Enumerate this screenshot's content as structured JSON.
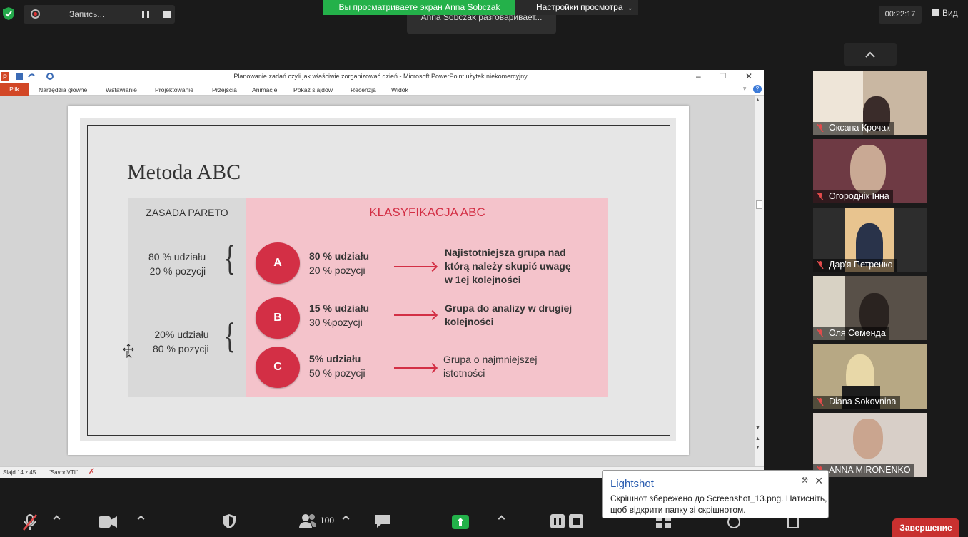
{
  "zoom": {
    "recording_label": "Запись...",
    "viewing_banner": "Вы просматриваете экран Anna Sobczak",
    "view_options": "Настройки просмотра",
    "speaking_label": "Anna Sobczak разговаривает...",
    "timer": "00:22:17",
    "view_button": "Вид",
    "participants_count": "100",
    "end_button": "Завершение",
    "participants": [
      {
        "name": "Оксана Крочак",
        "bg": "#c9b7a2"
      },
      {
        "name": "Огороднік Інна",
        "bg": "#6e3a44"
      },
      {
        "name": "Дар'я Петренко",
        "bg": "#2d2d2d"
      },
      {
        "name": "Оля Семенда",
        "bg": "#585048"
      },
      {
        "name": "Diana Sokovnina",
        "bg": "#b7a884"
      },
      {
        "name": "ANNA MIRONENKO",
        "bg": "#d8cfc8"
      }
    ]
  },
  "ppt": {
    "title": "Planowanie zadań czyli jak właściwie zorganizować dzień - Microsoft PowerPoint użytek niekomercyjny",
    "tabs": [
      "Plik",
      "Narzędzia główne",
      "Wstawianie",
      "Projektowanie",
      "Przejścia",
      "Animacje",
      "Pokaz slajdów",
      "Recenzja",
      "Widok"
    ],
    "status_slide": "Slajd 14 z 45",
    "status_theme": "\"SavonVTI\"",
    "slide": {
      "title": "Metoda ABC",
      "pareto_header": "ZASADA PARETO",
      "abc_header": "KLASYFIKACJA ABC",
      "pareto1_a": "80 % udziału",
      "pareto1_b": "20 % pozycji",
      "pareto2_a": "20% udziału",
      "pareto2_b": "80 % pozycji",
      "rows": [
        {
          "letter": "A",
          "pct1": "80 % udziału",
          "pct2": "20 % pozycji",
          "desc1": "Najistotniejsza grupa nad",
          "desc2": "którą należy skupić uwagę",
          "desc3": "w 1ej kolejności"
        },
        {
          "letter": "B",
          "pct1": "15 % udziału",
          "pct2": "30 %pozycji",
          "desc1": "Grupa do analizy w drugiej",
          "desc2": "kolejności",
          "desc3": ""
        },
        {
          "letter": "C",
          "pct1": "5% udziału",
          "pct2": "50 % pozycji",
          "desc1": "Grupa o najmniejszej",
          "desc2": "istotności",
          "desc3": ""
        }
      ]
    }
  },
  "lightshot": {
    "title": "Lightshot",
    "body": "Скрішнот збережено до Screenshot_13.png. Натисніть, щоб відкрити папку зі скрішнотом."
  }
}
